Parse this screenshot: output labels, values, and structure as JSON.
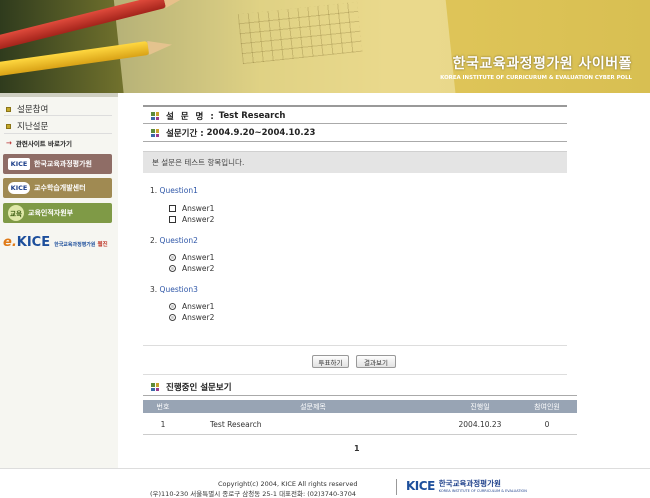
{
  "header": {
    "title": "한국교육과정평가원 사이버폴",
    "subtitle": "KOREA INSTITUTE OF CURRICURUM & EVALUATION CYBER POLL"
  },
  "sidebar": {
    "menu": [
      {
        "label": "설문참여"
      },
      {
        "label": "지난설문"
      }
    ],
    "related_label": "관련사이트 바로가기",
    "sites": [
      {
        "logo": "KICE",
        "label": "한국교육과정평가원"
      },
      {
        "logo": "KICE",
        "label": "교수학습개발센터"
      },
      {
        "logo": "교육",
        "label": "교육인적자원부"
      }
    ],
    "ekice": {
      "e": "e.",
      "k": "KICE",
      "text": "한국교육과정평가원",
      "tail": "웹진"
    }
  },
  "survey": {
    "name_label": "설 문 명 :",
    "name_value": "Test Research",
    "period_label": "설문기간 :",
    "period_value": "2004.9.20~2004.10.23",
    "intro": "본 설문은 테스트 항목입니다.",
    "questions": [
      {
        "number": "1.",
        "title": "Question1",
        "type": "checkbox",
        "answers": [
          "Answer1",
          "Answer2"
        ]
      },
      {
        "number": "2.",
        "title": "Question2",
        "type": "radio",
        "answers": [
          "Answer1",
          "Answer2"
        ]
      },
      {
        "number": "3.",
        "title": "Question3",
        "type": "radio",
        "answers": [
          "Answer1",
          "Answer2"
        ]
      }
    ],
    "vote_button": "투표하기",
    "result_button": "결과보기"
  },
  "ongoing": {
    "title": "진행중인 설문보기",
    "columns": [
      "번호",
      "설문제목",
      "진행일",
      "참여인원"
    ],
    "rows": [
      {
        "no": "1",
        "title": "Test Research",
        "date": "2004.10.23",
        "count": "0"
      }
    ],
    "page": "1"
  },
  "footer": {
    "copyright": "Copyright(c) 2004, KICE All rights reserved",
    "address": "(우)110-230 서울특별시 종로구 삼청동 25-1 대표전화: (02)3740-3704",
    "logo_k": "KICE",
    "logo_kr": "한국교육과정평가원",
    "logo_en": "KOREA INSTITUTE OF CURRICULUM & EVALUATION"
  },
  "colors": {
    "accent_blue": "#2f57a8",
    "table_header": "#98a4b4",
    "banner_gold": "#d8bf52"
  }
}
